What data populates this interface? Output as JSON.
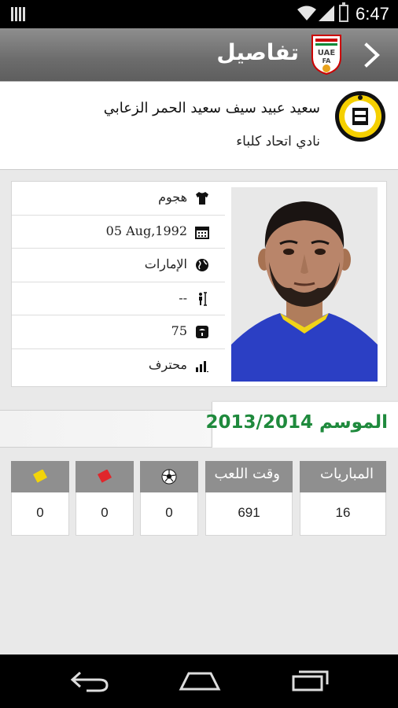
{
  "status_bar": {
    "time": "6:47",
    "icons": [
      "notification-icon",
      "wifi-icon",
      "signal-icon",
      "battery-icon"
    ]
  },
  "app_bar": {
    "title": "تفاصيل",
    "logo_text": "UAE FA",
    "back_icon": "chevron-right-icon"
  },
  "player": {
    "name": "سعيد عبيد سيف سعيد الحمر الزعابي",
    "club": "نادي اتحاد كلباء",
    "details": [
      {
        "icon": "shirt-icon",
        "value": "هجوم"
      },
      {
        "icon": "calendar-icon",
        "value": "05 Aug,1992"
      },
      {
        "icon": "globe-icon",
        "value": "الإمارات"
      },
      {
        "icon": "height-icon",
        "value": "--"
      },
      {
        "icon": "weight-scale-icon",
        "value": "75"
      },
      {
        "icon": "level-bars-icon",
        "value": "محترف"
      }
    ]
  },
  "season": {
    "label": "الموسم 2013/2014"
  },
  "stats": [
    {
      "header": "المباريات",
      "value": "16"
    },
    {
      "header": "وقت اللعب",
      "value": "691"
    },
    {
      "header": "",
      "icon": "football-icon",
      "value": "0"
    },
    {
      "header": "",
      "icon": "red-card-icon",
      "value": "0"
    },
    {
      "header": "",
      "icon": "yellow-card-icon",
      "value": "0"
    }
  ],
  "colors": {
    "accent_green": "#1f8a3d",
    "header_gray": "#8f8f8f",
    "red_card": "#e0262b",
    "yellow_card": "#f2d40a"
  }
}
